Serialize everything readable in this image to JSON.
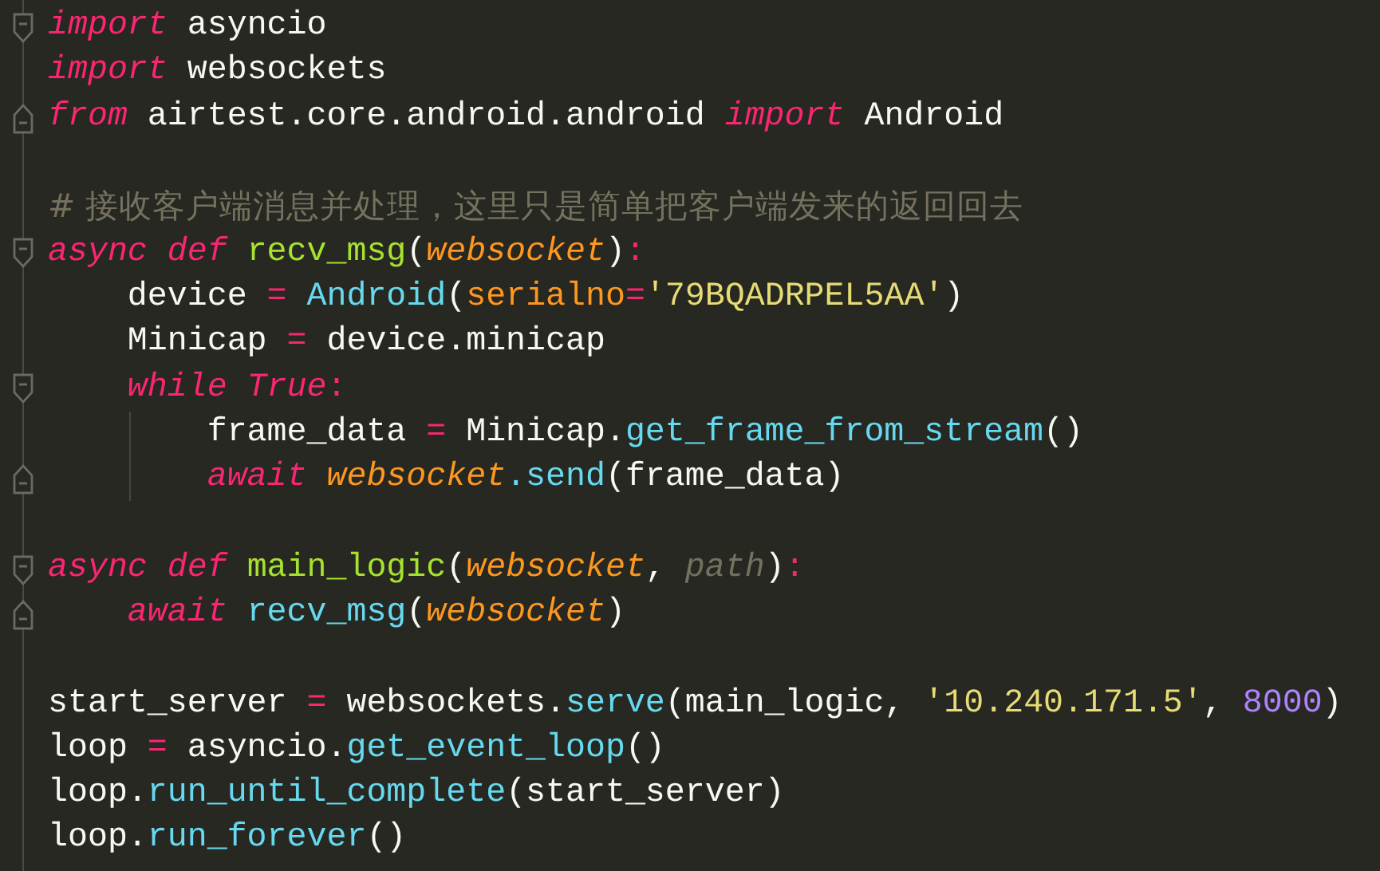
{
  "editor": {
    "lines": [
      {
        "fold_start": true,
        "tokens": [
          {
            "kind": "keyword",
            "text": "import "
          },
          {
            "kind": "plain",
            "text": "asyncio"
          }
        ]
      },
      {
        "tokens": [
          {
            "kind": "keyword",
            "text": "import "
          },
          {
            "kind": "plain",
            "text": "websockets"
          }
        ]
      },
      {
        "fold_end": true,
        "tokens": [
          {
            "kind": "keyword",
            "text": "from "
          },
          {
            "kind": "plain",
            "text": "airtest.core.android.android "
          },
          {
            "kind": "keyword",
            "text": "import "
          },
          {
            "kind": "plain",
            "text": "Android"
          }
        ]
      },
      {
        "gap_before": true,
        "tokens": [
          {
            "kind": "comment",
            "text": "# 接收客户端消息并处理，这里只是简单把客户端发来的返回回去"
          }
        ]
      },
      {
        "fold_start": true,
        "tokens": [
          {
            "kind": "keyword",
            "text": "async def "
          },
          {
            "kind": "function",
            "text": "recv_msg"
          },
          {
            "kind": "plain",
            "text": "("
          },
          {
            "kind": "param",
            "text": "websocket"
          },
          {
            "kind": "plain",
            "text": ")"
          },
          {
            "kind": "operator",
            "text": ":"
          }
        ]
      },
      {
        "tokens": [
          {
            "kind": "plain",
            "text": "    device "
          },
          {
            "kind": "operator",
            "text": "= "
          },
          {
            "kind": "builtin",
            "text": "Android"
          },
          {
            "kind": "plain",
            "text": "("
          },
          {
            "kind": "argname",
            "text": "serialno"
          },
          {
            "kind": "operator",
            "text": "="
          },
          {
            "kind": "string",
            "text": "'79BQADRPEL5AA'"
          },
          {
            "kind": "plain",
            "text": ")"
          }
        ]
      },
      {
        "tokens": [
          {
            "kind": "plain",
            "text": "    Minicap "
          },
          {
            "kind": "operator",
            "text": "="
          },
          {
            "kind": "plain",
            "text": " device.minicap"
          }
        ]
      },
      {
        "fold_start": true,
        "tokens": [
          {
            "kind": "keyword",
            "text": "    while True"
          },
          {
            "kind": "operator",
            "text": ":"
          }
        ]
      },
      {
        "guide": true,
        "tokens": [
          {
            "kind": "plain",
            "text": "        frame_data "
          },
          {
            "kind": "operator",
            "text": "="
          },
          {
            "kind": "plain",
            "text": " Minicap."
          },
          {
            "kind": "builtin",
            "text": "get_frame_from_stream"
          },
          {
            "kind": "plain",
            "text": "()"
          }
        ]
      },
      {
        "guide": true,
        "fold_end": true,
        "tokens": [
          {
            "kind": "keyword",
            "text": "        await "
          },
          {
            "kind": "param",
            "text": "websocket"
          },
          {
            "kind": "builtin",
            "text": ".send"
          },
          {
            "kind": "plain",
            "text": "(frame_data)"
          }
        ]
      },
      {
        "gap_before": true,
        "fold_start": true,
        "tokens": [
          {
            "kind": "keyword",
            "text": "async def "
          },
          {
            "kind": "function",
            "text": "main_logic"
          },
          {
            "kind": "plain",
            "text": "("
          },
          {
            "kind": "param",
            "text": "websocket"
          },
          {
            "kind": "punct",
            "text": ", "
          },
          {
            "kind": "param2",
            "text": "path"
          },
          {
            "kind": "plain",
            "text": ")"
          },
          {
            "kind": "operator",
            "text": ":"
          }
        ]
      },
      {
        "fold_end": true,
        "tokens": [
          {
            "kind": "keyword",
            "text": "    await "
          },
          {
            "kind": "builtin",
            "text": "recv_msg"
          },
          {
            "kind": "plain",
            "text": "("
          },
          {
            "kind": "param",
            "text": "websocket"
          },
          {
            "kind": "plain",
            "text": ")"
          }
        ]
      },
      {
        "gap_before": true,
        "tokens": [
          {
            "kind": "plain",
            "text": "start_server "
          },
          {
            "kind": "operator",
            "text": "="
          },
          {
            "kind": "plain",
            "text": " websockets."
          },
          {
            "kind": "builtin",
            "text": "serve"
          },
          {
            "kind": "plain",
            "text": "(main_logic"
          },
          {
            "kind": "punct",
            "text": ", "
          },
          {
            "kind": "string",
            "text": "'10.240.171.5'"
          },
          {
            "kind": "punct",
            "text": ", "
          },
          {
            "kind": "number",
            "text": "8000"
          },
          {
            "kind": "plain",
            "text": ")"
          }
        ]
      },
      {
        "tokens": [
          {
            "kind": "plain",
            "text": "loop "
          },
          {
            "kind": "operator",
            "text": "="
          },
          {
            "kind": "plain",
            "text": " asyncio."
          },
          {
            "kind": "builtin",
            "text": "get_event_loop"
          },
          {
            "kind": "plain",
            "text": "()"
          }
        ]
      },
      {
        "tokens": [
          {
            "kind": "plain",
            "text": "loop."
          },
          {
            "kind": "builtin",
            "text": "run_until_complete"
          },
          {
            "kind": "plain",
            "text": "(start_server)"
          }
        ]
      },
      {
        "tokens": [
          {
            "kind": "plain",
            "text": "loop."
          },
          {
            "kind": "builtin",
            "text": "run_forever"
          },
          {
            "kind": "plain",
            "text": "()"
          }
        ]
      }
    ]
  }
}
